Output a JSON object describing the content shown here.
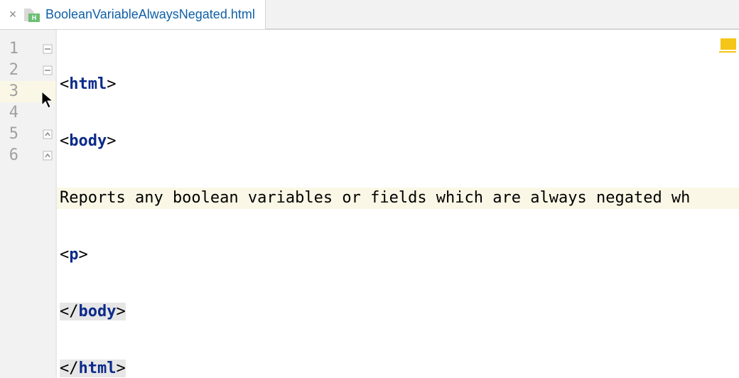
{
  "tab": {
    "filename": "BooleanVariableAlwaysNegated.html",
    "icon_badge": "H",
    "close_glyph": "×"
  },
  "gutter": {
    "lines": [
      "1",
      "2",
      "3",
      "4",
      "5",
      "6"
    ],
    "highlighted_line_index": 2
  },
  "code": {
    "lines": [
      {
        "type": "tag-open",
        "name": "html",
        "fold": "down"
      },
      {
        "type": "tag-open",
        "name": "body",
        "fold": "down"
      },
      {
        "type": "text",
        "text": "Reports any boolean variables or fields which are always negated wh",
        "highlight": true
      },
      {
        "type": "tag-open",
        "name": "p"
      },
      {
        "type": "tag-close",
        "name": "body",
        "fold": "up",
        "bg": true
      },
      {
        "type": "tag-close",
        "name": "html",
        "fold": "up",
        "bg": true
      }
    ]
  },
  "markers": {
    "warning": true
  }
}
